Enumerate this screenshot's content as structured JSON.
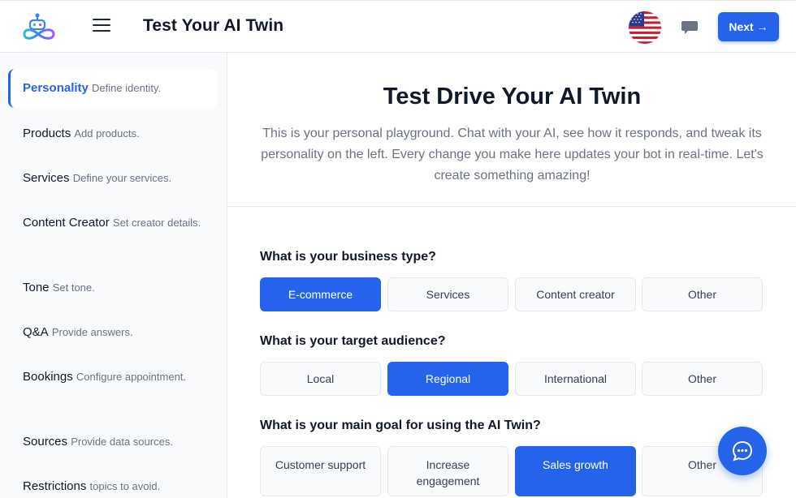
{
  "header": {
    "title": "Test Your AI Twin",
    "next_label": "Next →",
    "accent": "#2563eb"
  },
  "sidebar": {
    "items": [
      {
        "name": "Personality",
        "desc": "Define identity.",
        "active": true
      },
      {
        "name": "Products",
        "desc": "Add products."
      },
      {
        "name": "Services",
        "desc": "Define your services."
      },
      {
        "name": "Content Creator",
        "desc": "Set creator details."
      },
      {
        "name": "Tone",
        "desc": "Set tone."
      },
      {
        "name": "Q&A",
        "desc": "Provide answers."
      },
      {
        "name": "Bookings",
        "desc": "Configure appointment."
      },
      {
        "name": "Sources",
        "desc": "Provide data sources."
      },
      {
        "name": "Restrictions",
        "desc": "topics to avoid."
      }
    ]
  },
  "hero": {
    "title": "Test Drive Your AI Twin",
    "description": "This is your personal playground. Chat with your AI, see how it responds, and tweak its personality on the left. Every change you make here updates your bot in real-time. Let's create something amazing!"
  },
  "questions": [
    {
      "label": "What is your business type?",
      "options": [
        "E-commerce",
        "Services",
        "Content creator",
        "Other"
      ],
      "selected": "E-commerce"
    },
    {
      "label": "What is your target audience?",
      "options": [
        "Local",
        "Regional",
        "International",
        "Other"
      ],
      "selected": "Regional"
    },
    {
      "label": "What is your main goal for using the AI Twin?",
      "options": [
        "Customer support",
        "Increase engagement",
        "Sales growth",
        "Other"
      ],
      "selected": "Sales growth"
    }
  ],
  "icons": {
    "logo": "robot-infinity-logo",
    "menu": "hamburger-menu-icon",
    "language": "us-flag-icon",
    "chat": "chat-bubble-icon",
    "fab": "chat-dots-icon"
  }
}
